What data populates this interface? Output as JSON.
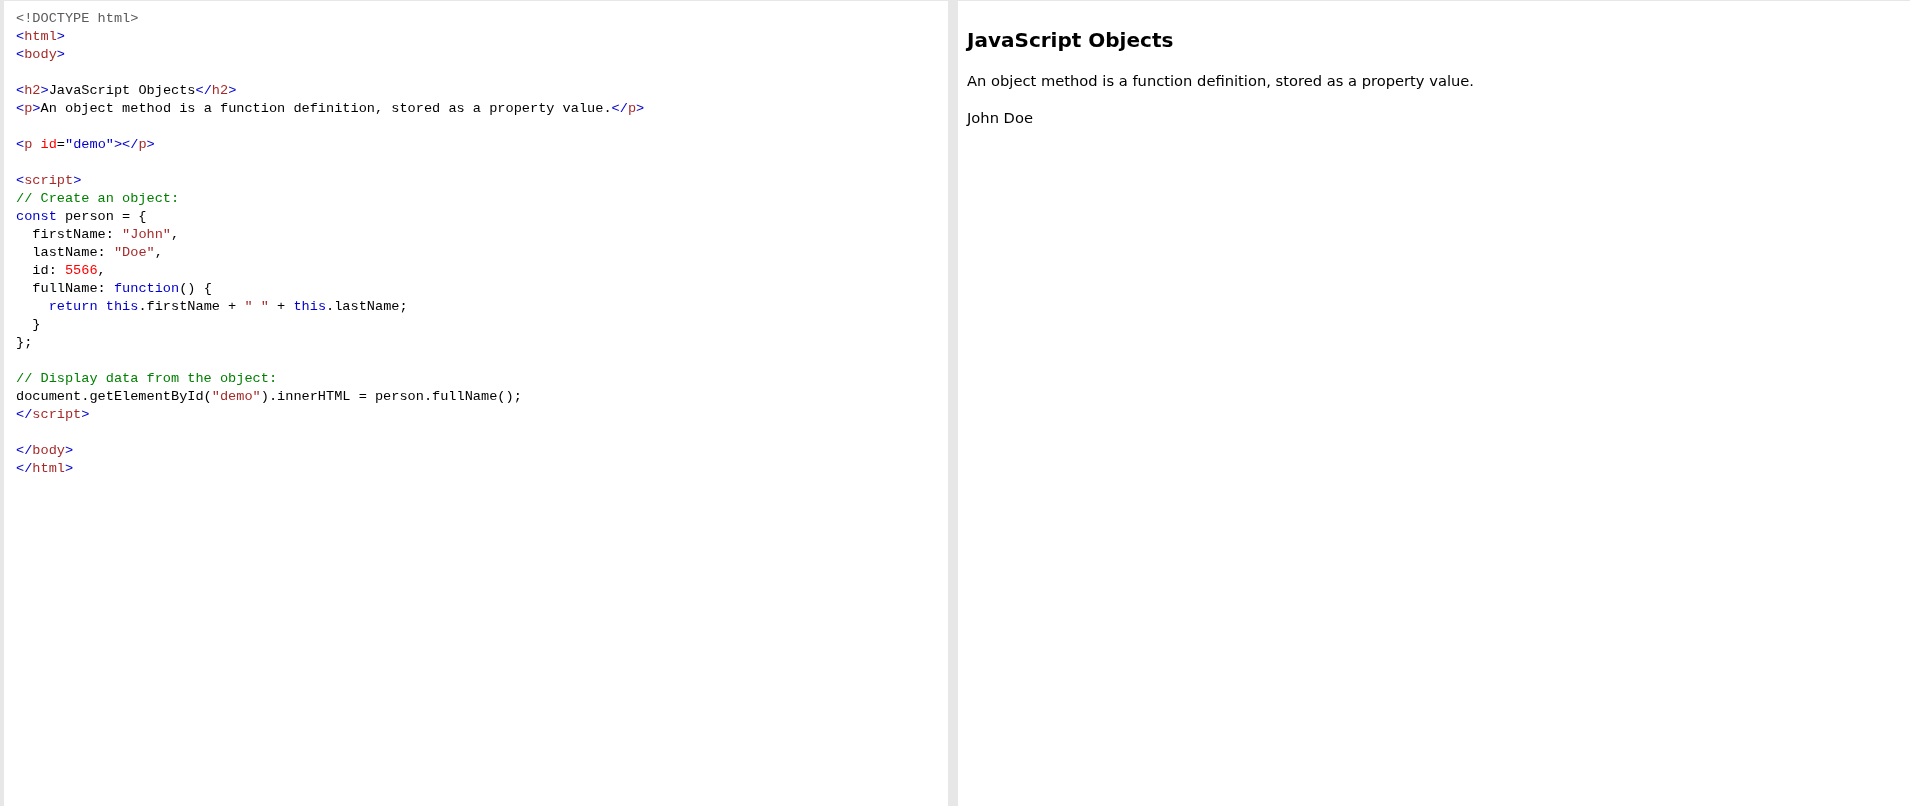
{
  "editor": {
    "blocks": [
      [
        [
          {
            "kind": "m",
            "text": "<!DOCTYPE html>"
          }
        ],
        [
          {
            "kind": "t",
            "text": "<"
          },
          {
            "kind": "n",
            "text": "html"
          },
          {
            "kind": "t",
            "text": ">"
          }
        ],
        [
          {
            "kind": "t",
            "text": "<"
          },
          {
            "kind": "n",
            "text": "body"
          },
          {
            "kind": "t",
            "text": ">"
          }
        ]
      ],
      [
        [
          {
            "kind": "t",
            "text": "<"
          },
          {
            "kind": "n",
            "text": "h2"
          },
          {
            "kind": "t",
            "text": ">"
          },
          {
            "kind": "p",
            "text": "JavaScript Objects"
          },
          {
            "kind": "t",
            "text": "</"
          },
          {
            "kind": "n",
            "text": "h2"
          },
          {
            "kind": "t",
            "text": ">"
          }
        ],
        [
          {
            "kind": "t",
            "text": "<"
          },
          {
            "kind": "n",
            "text": "p"
          },
          {
            "kind": "t",
            "text": ">"
          },
          {
            "kind": "p",
            "text": "An object method is a function definition, stored as a property value."
          },
          {
            "kind": "t",
            "text": "</"
          },
          {
            "kind": "n",
            "text": "p"
          },
          {
            "kind": "t",
            "text": ">"
          }
        ]
      ],
      [
        [
          {
            "kind": "t",
            "text": "<"
          },
          {
            "kind": "n",
            "text": "p"
          },
          {
            "kind": "a",
            "text": " id"
          },
          {
            "kind": "p",
            "text": "="
          },
          {
            "kind": "v",
            "text": "\"demo\""
          },
          {
            "kind": "t",
            "text": "></"
          },
          {
            "kind": "n",
            "text": "p"
          },
          {
            "kind": "t",
            "text": ">"
          }
        ]
      ],
      [
        [
          {
            "kind": "t",
            "text": "<"
          },
          {
            "kind": "n",
            "text": "script"
          },
          {
            "kind": "t",
            "text": ">"
          }
        ],
        [
          {
            "kind": "c",
            "text": "// Create an object:"
          }
        ],
        [
          {
            "kind": "k",
            "text": "const"
          },
          {
            "kind": "p",
            "text": " person = {"
          }
        ],
        [
          {
            "kind": "p",
            "text": "  firstName: "
          },
          {
            "kind": "s",
            "text": "\"John\""
          },
          {
            "kind": "p",
            "text": ","
          }
        ],
        [
          {
            "kind": "p",
            "text": "  lastName: "
          },
          {
            "kind": "s",
            "text": "\"Doe\""
          },
          {
            "kind": "p",
            "text": ","
          }
        ],
        [
          {
            "kind": "p",
            "text": "  id: "
          },
          {
            "kind": "d",
            "text": "5566"
          },
          {
            "kind": "p",
            "text": ","
          }
        ],
        [
          {
            "kind": "p",
            "text": "  fullName: "
          },
          {
            "kind": "k",
            "text": "function"
          },
          {
            "kind": "p",
            "text": "() {"
          }
        ],
        [
          {
            "kind": "k",
            "text": "    return this"
          },
          {
            "kind": "p",
            "text": ".firstName + "
          },
          {
            "kind": "s",
            "text": "\" \""
          },
          {
            "kind": "p",
            "text": " + "
          },
          {
            "kind": "k",
            "text": "this"
          },
          {
            "kind": "p",
            "text": ".lastName;"
          }
        ],
        [
          {
            "kind": "p",
            "text": "  }"
          }
        ],
        [
          {
            "kind": "p",
            "text": "};"
          }
        ]
      ],
      [
        [
          {
            "kind": "c",
            "text": "// Display data from the object:"
          }
        ],
        [
          {
            "kind": "p",
            "text": "document.getElementById("
          },
          {
            "kind": "s",
            "text": "\"demo\""
          },
          {
            "kind": "p",
            "text": ").innerHTML = person.fullName();"
          }
        ],
        [
          {
            "kind": "t",
            "text": "</"
          },
          {
            "kind": "n",
            "text": "script"
          },
          {
            "kind": "t",
            "text": ">"
          }
        ]
      ],
      [
        [
          {
            "kind": "t",
            "text": "</"
          },
          {
            "kind": "n",
            "text": "body"
          },
          {
            "kind": "t",
            "text": ">"
          }
        ],
        [
          {
            "kind": "t",
            "text": "</"
          },
          {
            "kind": "n",
            "text": "html"
          },
          {
            "kind": "t",
            "text": ">"
          }
        ]
      ]
    ]
  },
  "result": {
    "heading": "JavaScript Objects",
    "paragraph": "An object method is a function definition, stored as a property value.",
    "output": "John Doe"
  }
}
